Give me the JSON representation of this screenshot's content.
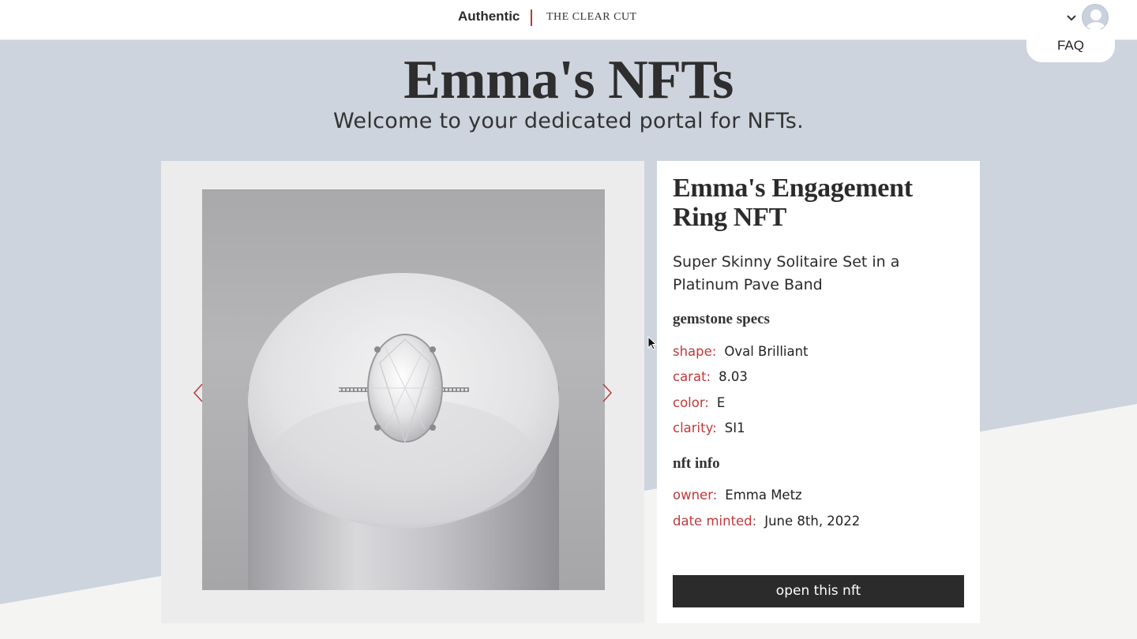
{
  "header": {
    "brand": "Authentic",
    "brand_sub": "THE CLEAR CUT",
    "faq_label": "FAQ"
  },
  "hero": {
    "title": "Emma's NFTs",
    "subtitle": "Welcome to your dedicated portal for NFTs."
  },
  "nft": {
    "title": "Emma's Engagement Ring NFT",
    "description": "Super Skinny Solitaire Set in a Platinum Pave Band",
    "gemstone_heading": "gemstone specs",
    "gemstone": [
      {
        "key": "shape:",
        "value": "Oval Brilliant"
      },
      {
        "key": "carat:",
        "value": "8.03"
      },
      {
        "key": "color:",
        "value": "E"
      },
      {
        "key": "clarity:",
        "value": "SI1"
      }
    ],
    "info_heading": "nft info",
    "info": [
      {
        "key": "owner:",
        "value": "Emma Metz"
      },
      {
        "key": "date minted:",
        "value": "June 8th, 2022"
      }
    ],
    "open_button": "open this nft"
  },
  "colors": {
    "accent": "#c0393b",
    "background": "#cdd4dd",
    "button": "#2b2b2b"
  }
}
